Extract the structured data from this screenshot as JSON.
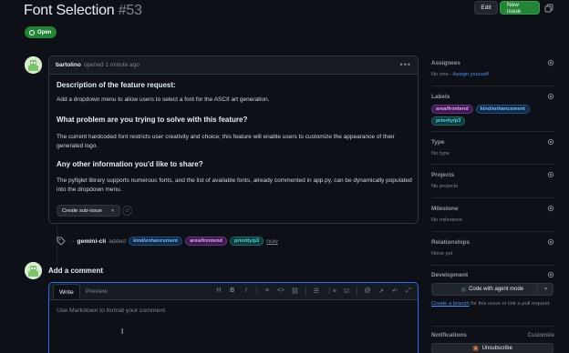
{
  "header": {
    "title": "Font Selection",
    "issue_number": "#53",
    "edit_label": "Edit",
    "new_issue_label": "New issue",
    "state": "Open"
  },
  "comment": {
    "author": "bartolino",
    "meta": "opened 1 minute ago",
    "heading1": "Description of the feature request:",
    "para1": "Add a dropdown menu to allow users to select a font for the ASCII art generation.",
    "heading2": "What problem are you trying to solve with this feature?",
    "para2": "The current hardcoded font restricts user creativity and choice; this feature will enable users to customize the appearance of their generated logo.",
    "heading3": "Any other information you'd like to share?",
    "para3": "The pyfiglet library supports numerous fonts, and the list of available fonts, already commented in app.py, can be dynamically populated into the dropdown menu.",
    "sub_issue_label": "Create sub-issue"
  },
  "event": {
    "actor": "gemini-cli",
    "action": "added",
    "labels": [
      "kind/enhancement",
      "area/frontend",
      "priority/p3"
    ],
    "time": "now"
  },
  "add_comment": {
    "title": "Add a comment",
    "tab_write": "Write",
    "tab_preview": "Preview",
    "toolbar": [
      "H",
      "B",
      "I",
      "≡",
      "<>",
      "🔗",
      "☰",
      "⋮≡",
      "☑",
      "@",
      "↗",
      "↶",
      "⤢"
    ],
    "placeholder": "Use Markdown to format your comment"
  },
  "sidebar": {
    "assignees": {
      "title": "Assignees",
      "value": "No one -",
      "action": "Assign yourself"
    },
    "labels": {
      "title": "Labels",
      "items": [
        "area/frontend",
        "kind/enhancement",
        "priority/p3"
      ]
    },
    "type": {
      "title": "Type",
      "value": "No type"
    },
    "projects": {
      "title": "Projects",
      "value": "No projects"
    },
    "milestone": {
      "title": "Milestone",
      "value": "No milestone"
    },
    "relationships": {
      "title": "Relationships",
      "value": "None yet"
    },
    "development": {
      "title": "Development",
      "agent_button": "Code with agent mode",
      "branch_link": "Create a branch",
      "branch_text": " for this issue or link a pull request."
    },
    "notifications": {
      "title": "Notifications",
      "action": "Customize",
      "unsubscribe": "Unsubscribe"
    }
  },
  "colors": {
    "background": "#0d1117",
    "accent_green": "#238636",
    "link_blue": "#4493f8",
    "focus_blue": "#1f6feb"
  }
}
